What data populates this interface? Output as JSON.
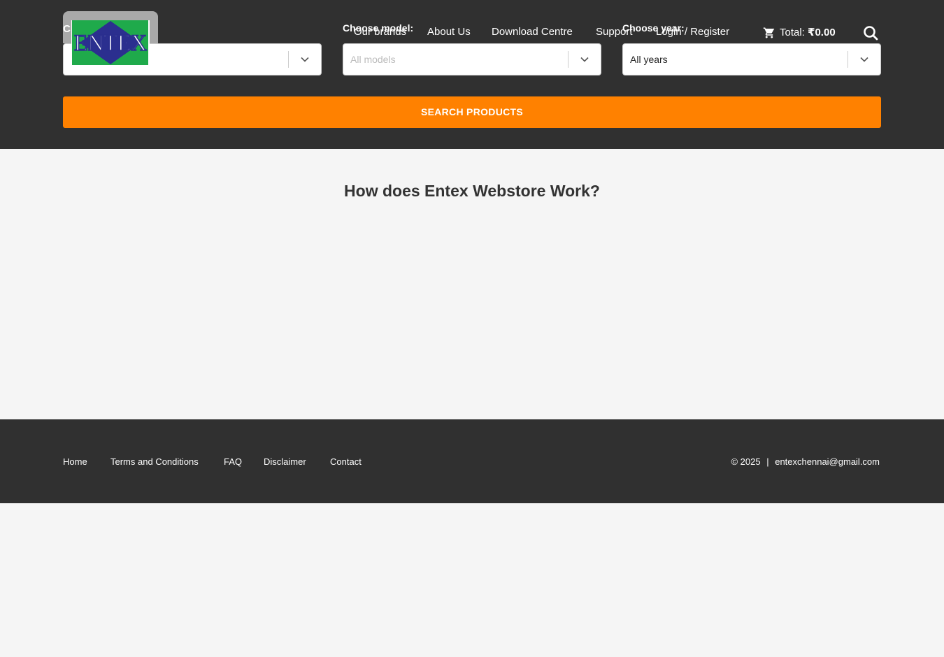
{
  "brand": {
    "logo_text": "ENTEX",
    "cutoff_label": "C"
  },
  "filters": {
    "model": {
      "label": "Choose model:",
      "placeholder": "All models"
    },
    "year": {
      "label": "Choose year:",
      "value": "All years"
    }
  },
  "nav": {
    "items": [
      {
        "label": "Our brands"
      },
      {
        "label": "About Us"
      },
      {
        "label": "Download Centre"
      },
      {
        "label": "Support"
      },
      {
        "label": "Login / Register"
      }
    ],
    "cart": {
      "label": "Total:",
      "amount": "₹0.00"
    }
  },
  "search_button": {
    "label": "SEARCH PRODUCTS"
  },
  "main": {
    "title": "How does Entex Webstore Work?"
  },
  "footer": {
    "links": [
      {
        "label": "Home"
      },
      {
        "label": "Terms and Conditions"
      },
      {
        "label": "FAQ"
      },
      {
        "label": "Disclaimer"
      },
      {
        "label": "Contact"
      }
    ],
    "copyright": "© 2025",
    "separator": "|",
    "email": "entexchennai@gmail.com"
  },
  "colors": {
    "header_bg": "#303030",
    "accent": "#ff8100",
    "page_bg": "#f5f5f5",
    "logo_green": "#1faa4b",
    "logo_blue": "#2b2f8f"
  }
}
